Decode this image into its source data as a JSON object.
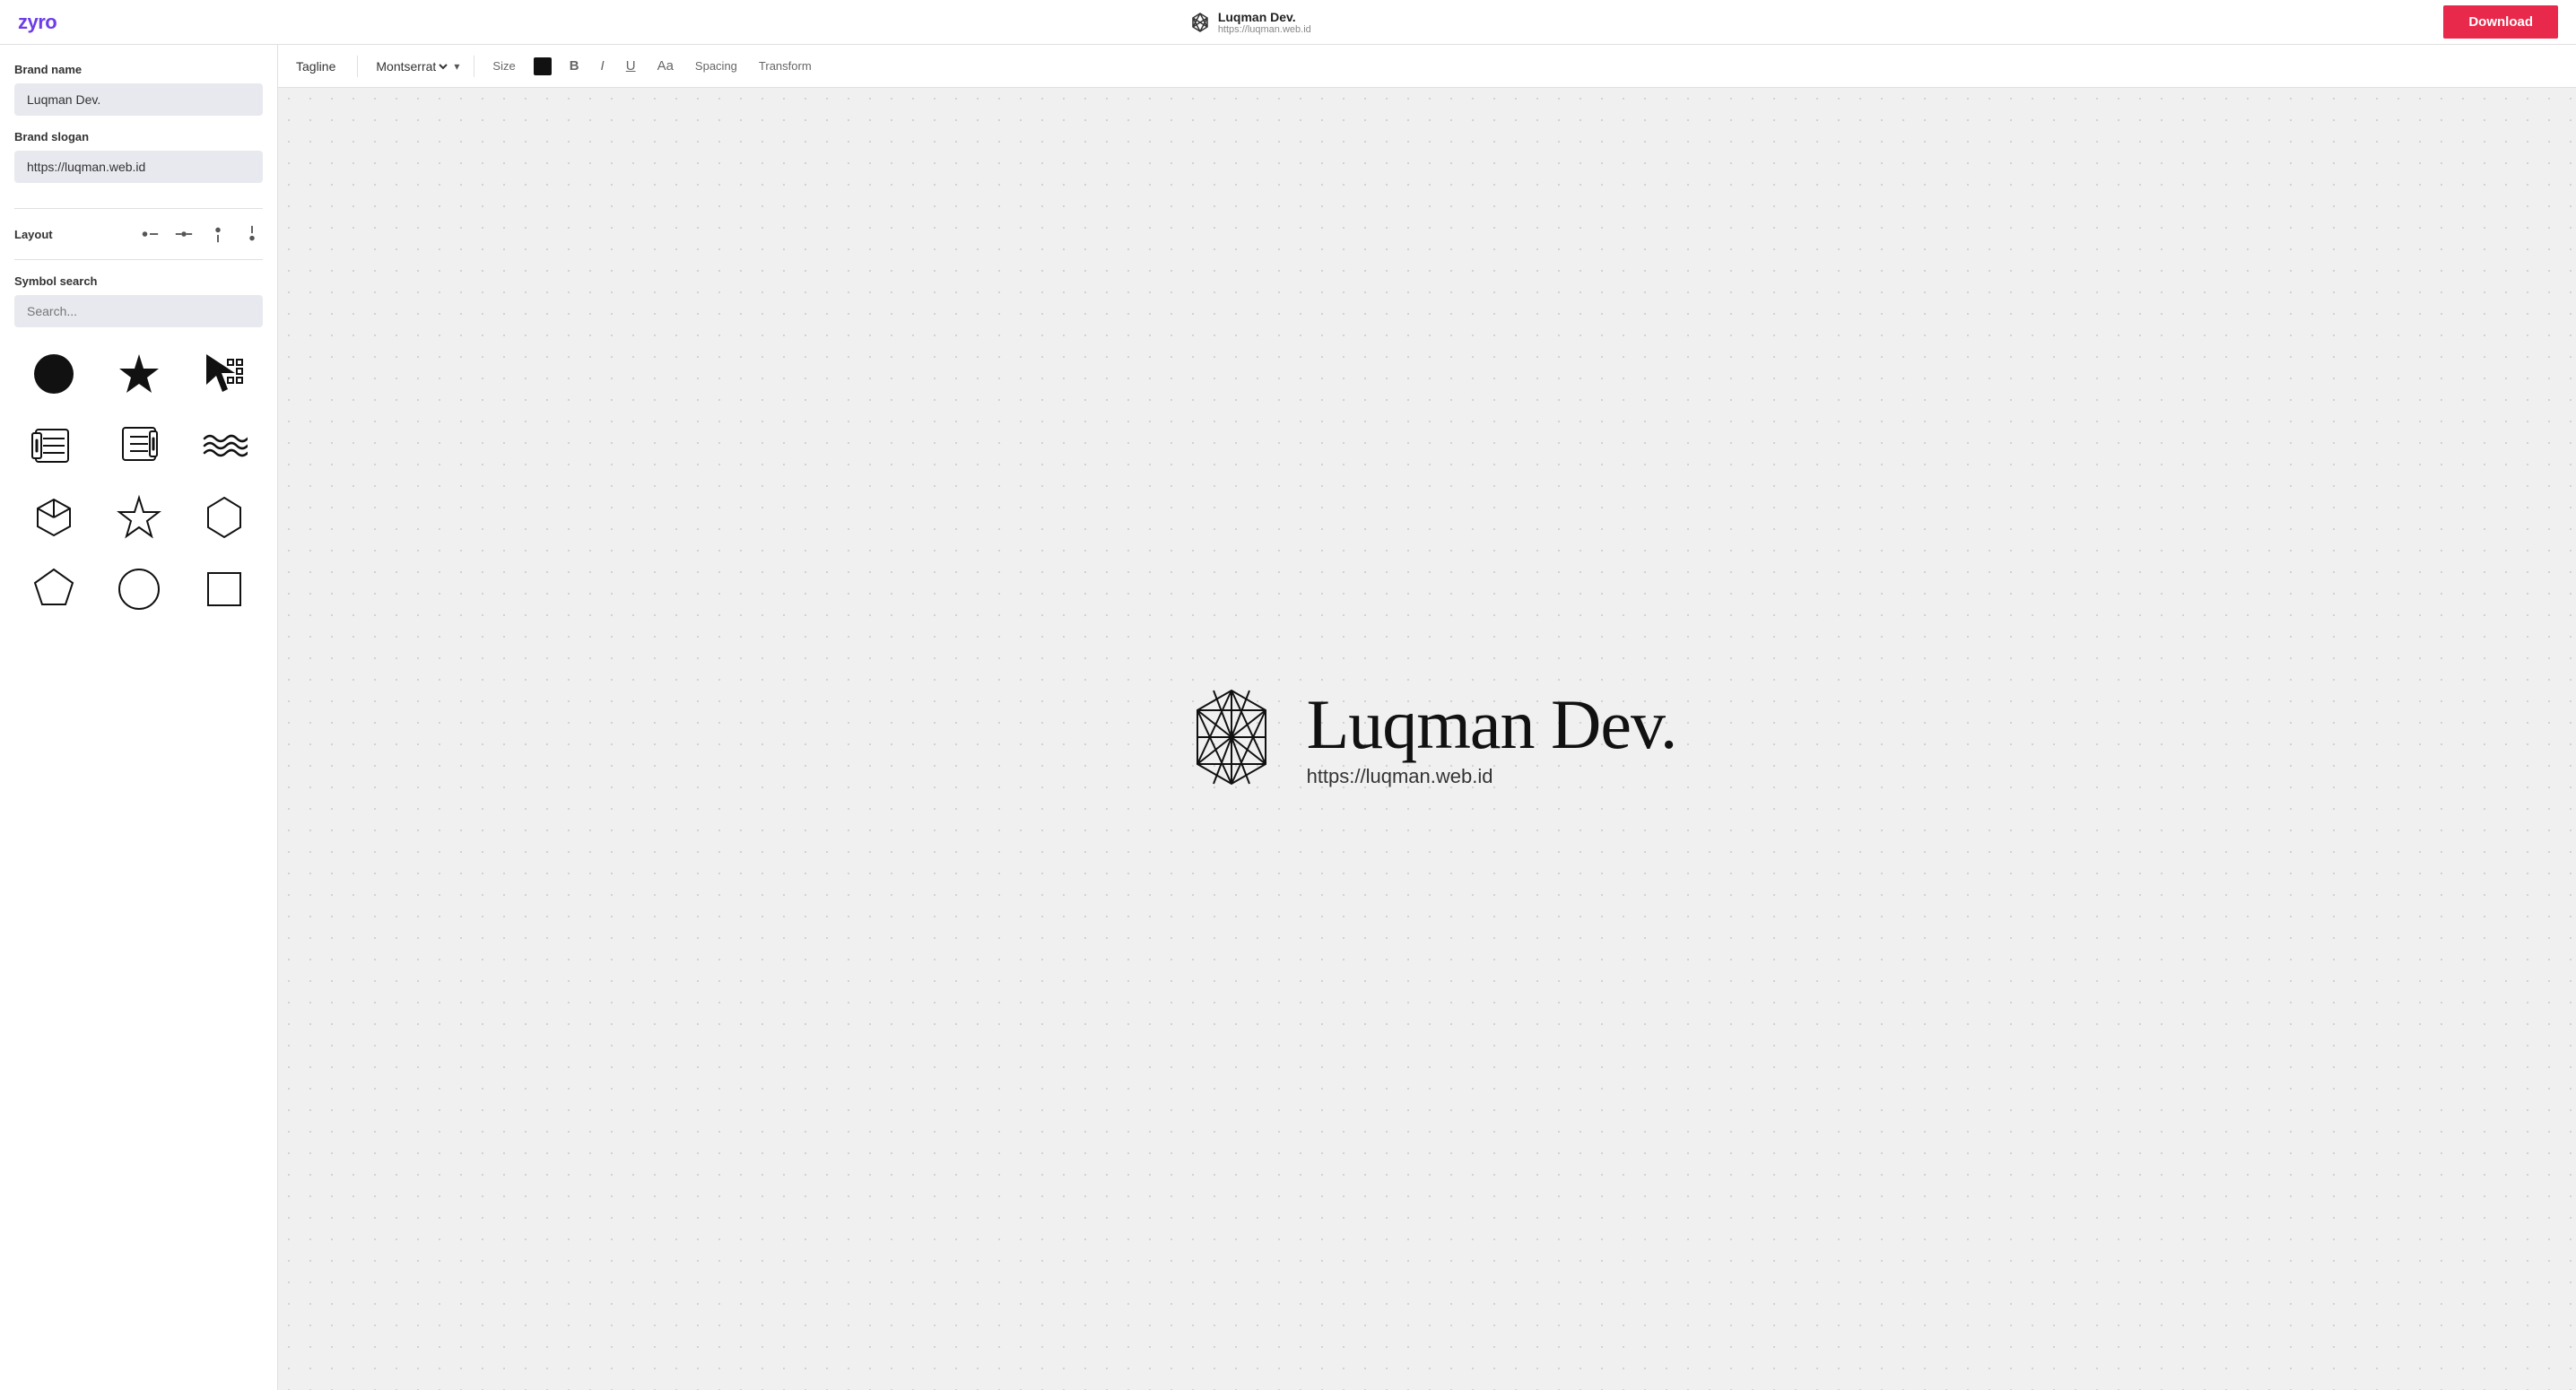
{
  "app": {
    "logo": "zyro",
    "download_label": "Download"
  },
  "center_logo": {
    "icon_alt": "zyro-logo-icon",
    "title": "Luqman Dev.",
    "subtitle": "https://luqman.web.id"
  },
  "toolbar": {
    "tagline_label": "Tagline",
    "font_name": "Montserrat",
    "size_label": "Size",
    "bold_label": "B",
    "italic_label": "I",
    "underline_label": "U",
    "aa_label": "Aa",
    "spacing_label": "Spacing",
    "transform_label": "Transform",
    "color": "#111111"
  },
  "sidebar": {
    "brand_name_label": "Brand name",
    "brand_name_value": "Luqman Dev.",
    "brand_slogan_label": "Brand slogan",
    "brand_slogan_value": "https://luqman.web.id",
    "layout_label": "Layout",
    "symbol_search_label": "Symbol search",
    "symbol_search_placeholder": "Search..."
  },
  "preview": {
    "brand_name": "Luqman Dev.",
    "slogan": "https://luqman.web.id"
  },
  "symbols": [
    "circle-filled",
    "star-filled",
    "cursor-tool",
    "scroll-list-1",
    "scroll-list-2",
    "waves",
    "cube",
    "star-outline",
    "hexagon-outline",
    "pentagon-outline",
    "circle-outline",
    "square-outline"
  ]
}
